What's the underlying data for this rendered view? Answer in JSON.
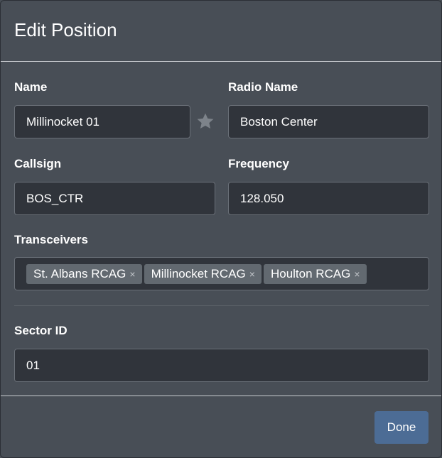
{
  "dialog": {
    "title": "Edit Position"
  },
  "form": {
    "name": {
      "label": "Name",
      "value": "Millinocket 01"
    },
    "radio_name": {
      "label": "Radio Name",
      "value": "Boston Center"
    },
    "callsign": {
      "label": "Callsign",
      "value": "BOS_CTR"
    },
    "frequency": {
      "label": "Frequency",
      "value": "128.050"
    },
    "transceivers": {
      "label": "Transceivers",
      "tags": [
        "St. Albans RCAG",
        "Millinocket RCAG",
        "Houlton RCAG"
      ],
      "remove_glyph": "×"
    },
    "sector_id": {
      "label": "Sector ID",
      "value": "01"
    }
  },
  "footer": {
    "done_label": "Done"
  },
  "icons": {
    "favorite": "star-icon",
    "remove": "close-icon"
  },
  "colors": {
    "background": "#484e56",
    "input_bg": "#30343b",
    "tag_bg": "#626970",
    "primary_button": "#4c6c95",
    "star": "#7d838a"
  }
}
